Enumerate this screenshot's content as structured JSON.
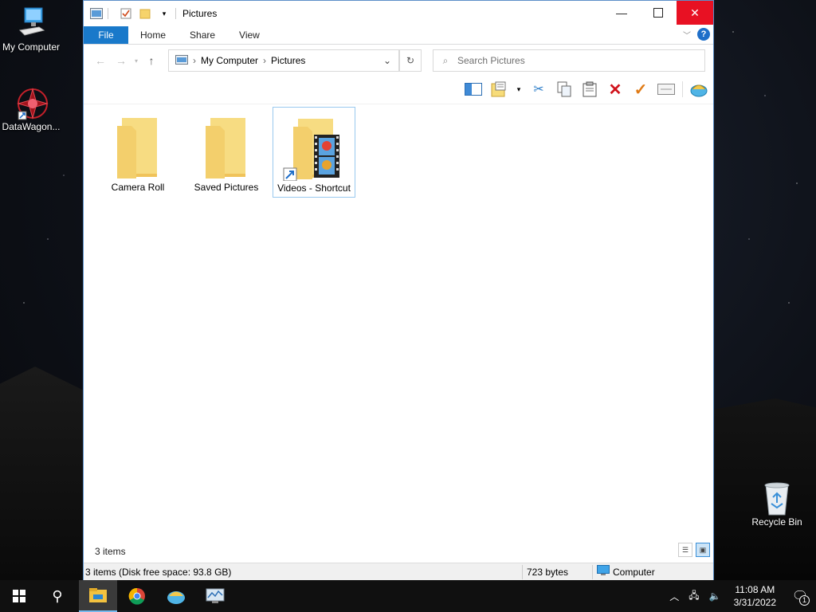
{
  "desktop": {
    "icons": [
      {
        "label": "My Computer",
        "icon": "computer-icon"
      },
      {
        "label": "DataWagon...",
        "icon": "datawagon-icon"
      },
      {
        "label": "Recycle Bin",
        "icon": "recycle-bin-icon"
      }
    ]
  },
  "window": {
    "title": "Pictures",
    "ribbon_tabs": [
      "File",
      "Home",
      "Share",
      "View"
    ],
    "help_label": "?",
    "address": {
      "crumbs": [
        "My Computer",
        "Pictures"
      ]
    },
    "search_placeholder": "Search Pictures",
    "items": [
      {
        "label": "Camera Roll",
        "type": "folder"
      },
      {
        "label": "Saved Pictures",
        "type": "folder"
      },
      {
        "label": "Videos - Shortcut",
        "type": "shortcut"
      }
    ],
    "item_count": "3 items",
    "status": {
      "summary": "3 items (Disk free space: 93.8 GB)",
      "size": "723 bytes",
      "location": "Computer"
    }
  },
  "taskbar": {
    "time": "11:08 AM",
    "date": "3/31/2022",
    "notification_count": "1"
  },
  "colors": {
    "accent": "#1979ca",
    "close": "#e81123",
    "selection": "#99c9ef"
  }
}
